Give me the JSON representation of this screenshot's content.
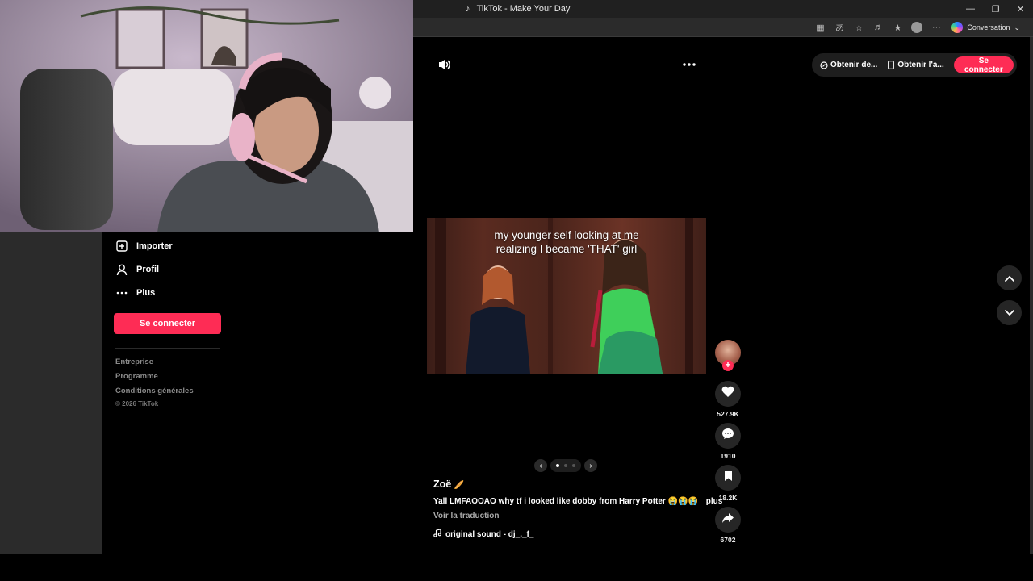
{
  "window": {
    "title": "TikTok - Make Your Day"
  },
  "browser": {
    "copilot_label": "Conversation"
  },
  "sidebar": {
    "items": [
      {
        "label": "Importer",
        "icon": "upload-icon"
      },
      {
        "label": "Profil",
        "icon": "user-icon"
      },
      {
        "label": "Plus",
        "icon": "more-icon"
      }
    ],
    "login_label": "Se connecter",
    "footer_links": [
      "Entreprise",
      "Programme",
      "Conditions générales"
    ],
    "copyright": "© 2026 TikTok"
  },
  "topbar": {
    "link1": "Obtenir de...",
    "link2": "Obtenir l'a...",
    "login_label": "Se connecter"
  },
  "video": {
    "caption_line1": "my younger self looking at me",
    "caption_line2": "realizing I became 'THAT' girl",
    "carousel": {
      "total": 3,
      "active": 1
    }
  },
  "post": {
    "author": "Zoë",
    "author_emoji": "🥖",
    "description": "Yall LMFAOOAO why tf i looked like dobby from Harry Potter 😭😭😭",
    "more_label": "plus",
    "translate_label": "Voir la traduction",
    "sound": "original sound - dj_._f_"
  },
  "actions": {
    "likes": "527.9K",
    "comments": "1910",
    "saves": "18.2K",
    "shares": "6702"
  },
  "colors": {
    "accent": "#fe2c55",
    "background": "#000000",
    "chrome": "#202020"
  }
}
